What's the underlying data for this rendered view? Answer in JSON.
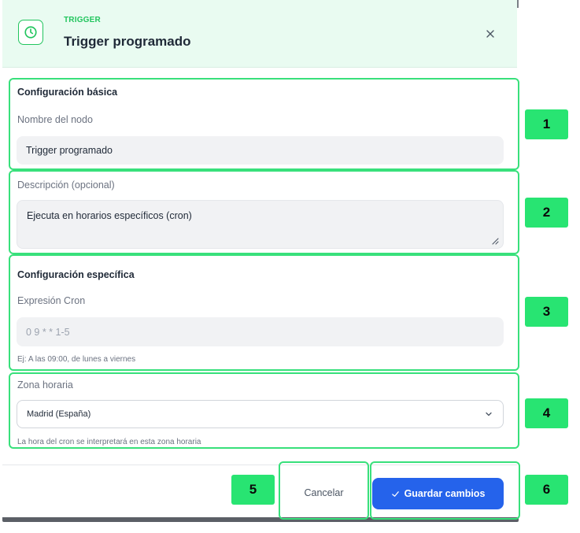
{
  "header": {
    "kicker": "TRIGGER",
    "title": "Trigger programado",
    "icon": "clock-icon",
    "close_icon": "close-icon"
  },
  "basic": {
    "section_title": "Configuración básica",
    "name_label": "Nombre del nodo",
    "name_value": "Trigger programado",
    "description_label": "Descripción (opcional)",
    "description_value": "Ejecuta en horarios específicos (cron)"
  },
  "specific": {
    "section_title": "Configuración específica",
    "cron_label": "Expresión Cron",
    "cron_placeholder": "0 9 * * 1-5",
    "cron_hint": "Ej: A las 09:00, de lunes a viernes",
    "timezone_label": "Zona horaria",
    "timezone_value": "Madrid (España)",
    "timezone_hint": "La hora del cron se interpretará en esta zona horaria"
  },
  "footer": {
    "cancel_label": "Cancelar",
    "save_label": "Guardar cambios",
    "save_icon": "check-icon"
  },
  "markers": [
    "1",
    "2",
    "3",
    "4",
    "5",
    "6"
  ],
  "colors": {
    "accent_green": "#22c55e",
    "header_bg": "#e9fbf1",
    "highlight_green": "#38e07b",
    "primary_blue": "#2563eb",
    "field_bg": "#f1f2f4"
  }
}
